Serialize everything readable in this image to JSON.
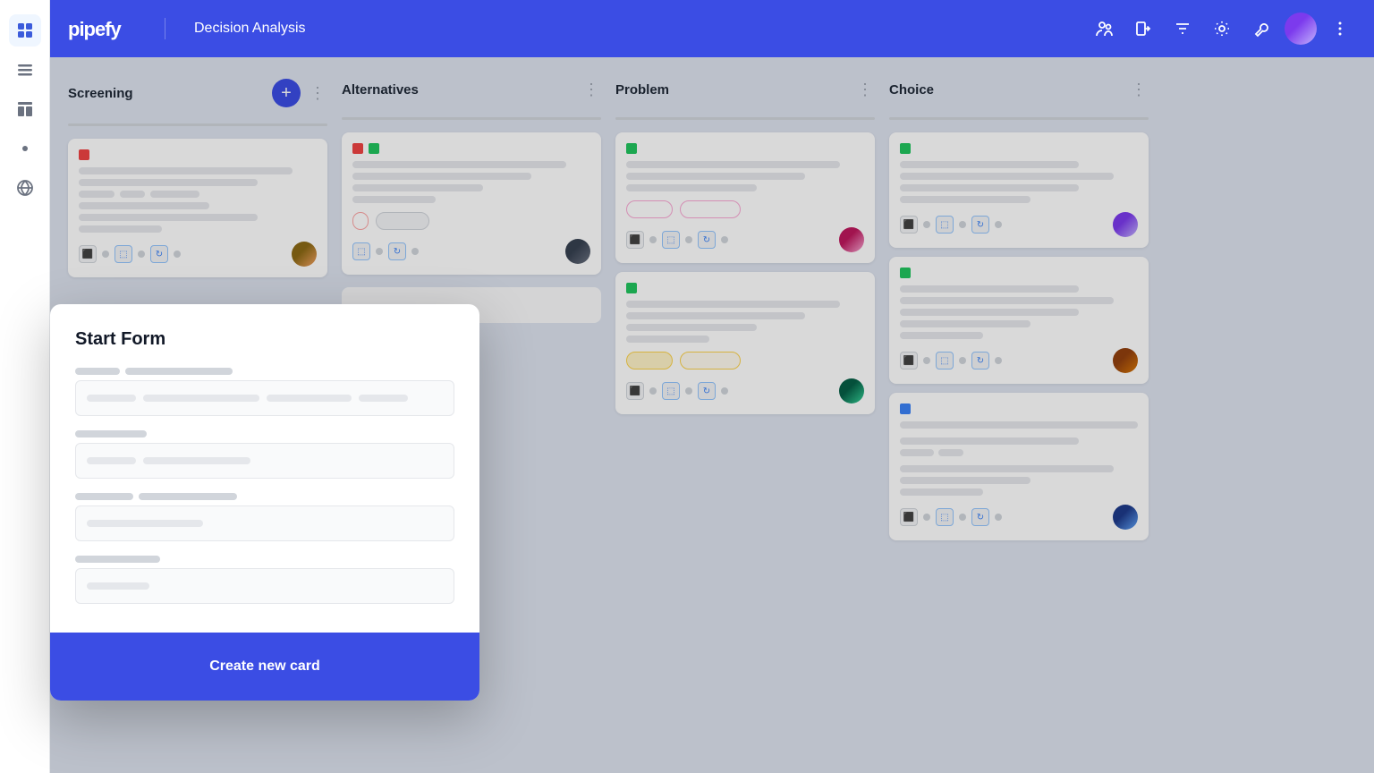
{
  "app": {
    "title": "Decision Analysis",
    "logo": "pipefy"
  },
  "sidebar": {
    "icons": [
      {
        "name": "grid-icon",
        "symbol": "⊞",
        "active": true
      },
      {
        "name": "list-icon",
        "symbol": "≡",
        "active": false
      },
      {
        "name": "table-icon",
        "symbol": "⊟",
        "active": false
      },
      {
        "name": "robot-icon",
        "symbol": "⚙",
        "active": false
      },
      {
        "name": "globe-icon",
        "symbol": "🌐",
        "active": false
      }
    ]
  },
  "topbar": {
    "actions": [
      "users-icon",
      "login-icon",
      "filter-icon",
      "settings-icon",
      "tools-icon",
      "more-icon"
    ]
  },
  "columns": [
    {
      "id": "screening",
      "title": "Screening",
      "has_add": true
    },
    {
      "id": "alternatives",
      "title": "Alternatives",
      "has_add": false
    },
    {
      "id": "problem",
      "title": "Problem",
      "has_add": false
    },
    {
      "id": "choice",
      "title": "Choice",
      "has_add": false
    }
  ],
  "modal": {
    "title": "Start Form",
    "field1_label_w1": 50,
    "field1_label_w2": 120,
    "field1_placeholder_w1": 55,
    "field1_placeholder_w2": 130,
    "field1_placeholder_w3": 95,
    "field1_placeholder_w4": 55,
    "field2_label_w": 80,
    "field2_placeholder_w1": 55,
    "field2_placeholder_w2": 120,
    "field3_label_w1": 65,
    "field3_label_w2": 110,
    "field3_placeholder_w": 130,
    "field4_label_w": 95,
    "field4_placeholder_w": 70,
    "create_button": "Create new card"
  }
}
